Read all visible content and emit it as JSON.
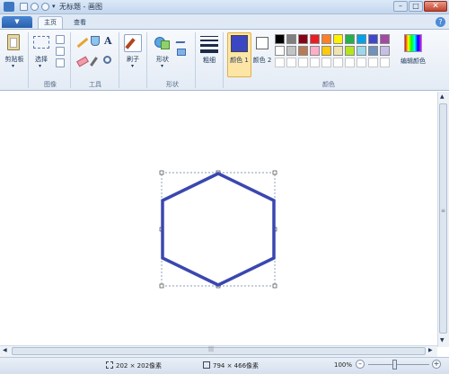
{
  "window": {
    "title": "无标题 - 画图",
    "min": "–",
    "max": "□",
    "close": "✕"
  },
  "tabs": {
    "file": "▼",
    "home": "主页",
    "view": "查看"
  },
  "help": "?",
  "ribbon": {
    "clipboard": "剪贴板",
    "select": "选择",
    "image_group": "图像",
    "tools_group": "工具",
    "text_tool": "A",
    "brushes": "刷子",
    "shapes": "形状",
    "shapes_group": "形状",
    "size": "粗细",
    "color1": "颜色 1",
    "color2": "颜色 2",
    "edit_colors": "编辑颜色",
    "colors_group": "颜色"
  },
  "colors": {
    "color1": "#3b47c2",
    "color2": "#ffffff",
    "palette_row1": [
      "#000000",
      "#7f7f7f",
      "#880015",
      "#ed1c24",
      "#ff7f27",
      "#fff200",
      "#22b14c",
      "#00a2e8",
      "#3f48cc",
      "#a349a4"
    ],
    "palette_row2": [
      "#ffffff",
      "#c3c3c3",
      "#b97a57",
      "#ffaec9",
      "#ffc90e",
      "#efe4b0",
      "#b5e61d",
      "#99d9ea",
      "#7092be",
      "#c8bfe7"
    ],
    "hexagon_stroke": "#3b47b0"
  },
  "status": {
    "selection_size": "202 × 202像素",
    "image_size": "794 × 466像素",
    "zoom": "100%",
    "zoom_out": "–",
    "zoom_in": "+"
  }
}
